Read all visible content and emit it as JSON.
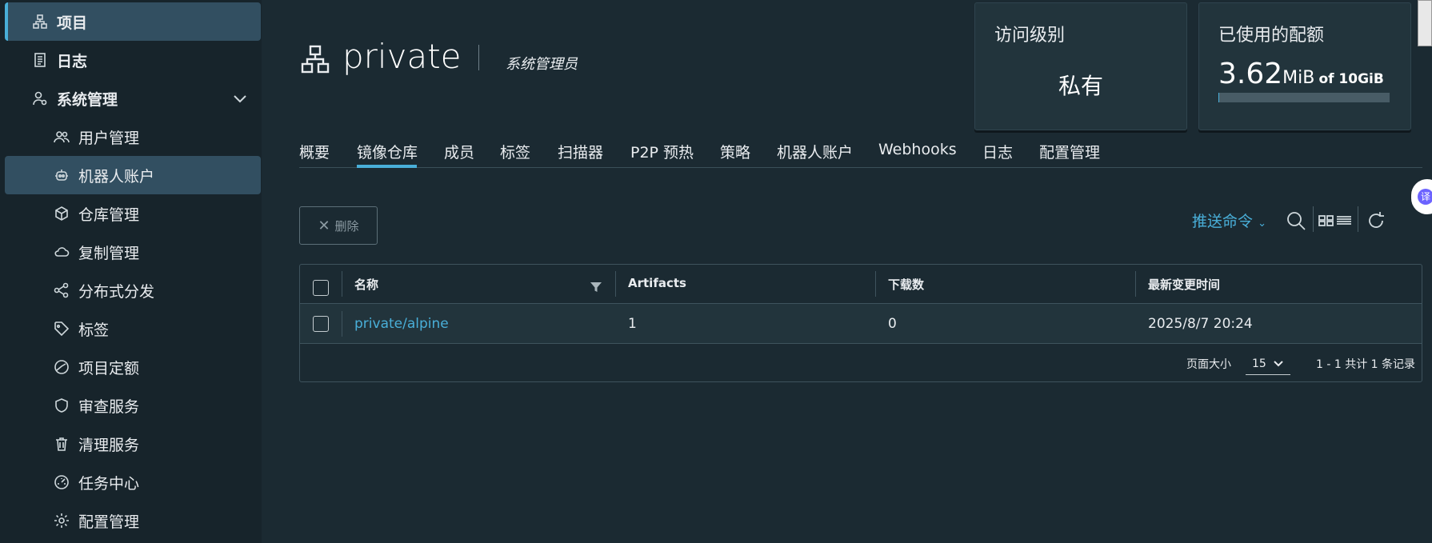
{
  "sidebar": {
    "items": [
      {
        "label": "项目",
        "icon": "project-icon"
      },
      {
        "label": "日志",
        "icon": "log-icon"
      },
      {
        "label": "系统管理",
        "icon": "admin-icon"
      },
      {
        "label": "用户管理",
        "icon": "users-icon"
      },
      {
        "label": "机器人账户",
        "icon": "robot-icon"
      },
      {
        "label": "仓库管理",
        "icon": "registry-icon"
      },
      {
        "label": "复制管理",
        "icon": "cloud-icon"
      },
      {
        "label": "分布式分发",
        "icon": "share-icon"
      },
      {
        "label": "标签",
        "icon": "tag-icon"
      },
      {
        "label": "项目定额",
        "icon": "quota-icon"
      },
      {
        "label": "审查服务",
        "icon": "shield-icon"
      },
      {
        "label": "清理服务",
        "icon": "trash-icon"
      },
      {
        "label": "任务中心",
        "icon": "dashboard-icon"
      },
      {
        "label": "配置管理",
        "icon": "gear-icon"
      }
    ]
  },
  "header": {
    "project_name": "private",
    "role": "系统管理员"
  },
  "cards": {
    "access_level": {
      "title": "访问级别",
      "value": "私有"
    },
    "quota": {
      "title": "已使用的配额",
      "used": "3.62",
      "used_unit": "MiB",
      "of_text": "of 10GiB",
      "used_fraction": 0.0004
    }
  },
  "tabs": [
    "概要",
    "镜像仓库",
    "成员",
    "标签",
    "扫描器",
    "P2P 预热",
    "策略",
    "机器人账户",
    "Webhooks",
    "日志",
    "配置管理"
  ],
  "active_tab": "镜像仓库",
  "toolbar": {
    "delete_label": "删除",
    "push_command_label": "推送命令"
  },
  "table": {
    "columns": [
      "名称",
      "Artifacts",
      "下载数",
      "最新变更时间"
    ],
    "rows": [
      {
        "name": "private/alpine",
        "artifacts": "1",
        "downloads": "0",
        "updated": "2025/8/7 20:24"
      }
    ],
    "page_size_label": "页面大小",
    "page_size": "15",
    "summary": "1 - 1 共计 1 条记录"
  },
  "float_badge": {
    "text": "译"
  },
  "colors": {
    "accent": "#49afd9",
    "background": "#1b2a32",
    "sidebar": "#17242b",
    "active": "#324f61"
  }
}
